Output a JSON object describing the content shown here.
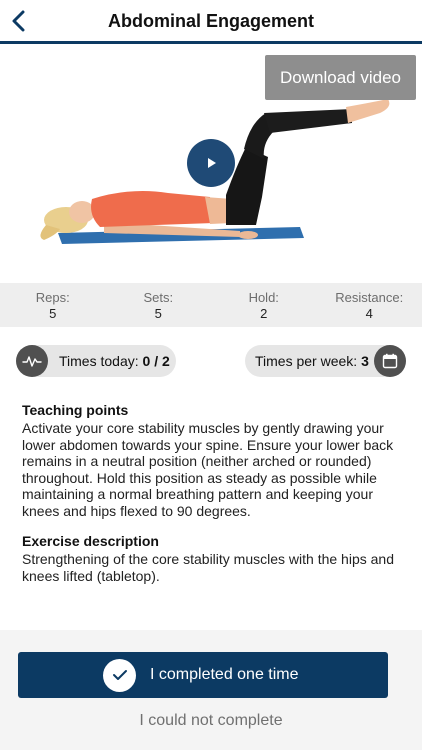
{
  "header": {
    "title": "Abdominal Engagement"
  },
  "video": {
    "download_label": "Download video"
  },
  "stats": [
    {
      "label": "Reps:",
      "value": "5"
    },
    {
      "label": "Sets:",
      "value": "5"
    },
    {
      "label": "Hold:",
      "value": "2"
    },
    {
      "label": "Resistance:",
      "value": "4"
    }
  ],
  "times_today": {
    "label": "Times today:",
    "value": "0 / 2"
  },
  "times_per_week": {
    "label": "Times per week:",
    "value": "3"
  },
  "teaching_points": {
    "title": "Teaching points",
    "body": "Activate your core stability muscles by gently drawing your lower abdomen towards your spine.   Ensure your lower back remains in a neutral position (neither arched or rounded) throughout.  Hold this position as steady as possible while maintaining a normal breathing pattern and keeping your knees and hips flexed to 90 degrees."
  },
  "exercise_description": {
    "title": "Exercise description",
    "body": "Strengthening of the core stability muscles with the hips and knees lifted (tabletop)."
  },
  "footer": {
    "completed_label": "I completed one time",
    "not_complete_label": "I could not complete"
  },
  "colors": {
    "primary": "#0c3a63",
    "play": "#1f4a76"
  }
}
